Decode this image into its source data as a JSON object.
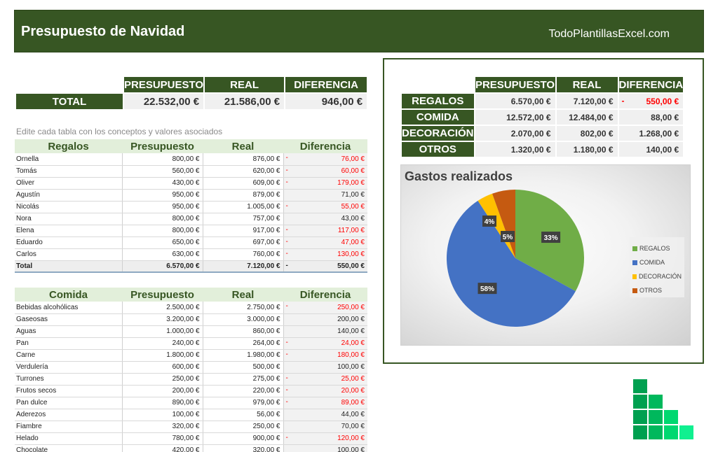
{
  "header": {
    "title": "Presupuesto de Navidad",
    "site": "TodoPlantillasExcel.com"
  },
  "summary": {
    "columns": [
      "PRESUPUESTO",
      "REAL",
      "DIFERENCIA"
    ],
    "row_label": "TOTAL",
    "values": [
      "22.532,00 €",
      "21.586,00 €",
      "946,00 €"
    ]
  },
  "hint": "Edite cada tabla con los conceptos y valores asociados",
  "tables": [
    {
      "headers": [
        "Regalos",
        "Presupuesto",
        "Real",
        "Diferencia"
      ],
      "rows": [
        {
          "name": "Ornella",
          "pre": "800,00 €",
          "real": "876,00 €",
          "dif": "76,00 €",
          "neg": true
        },
        {
          "name": "Tomás",
          "pre": "560,00 €",
          "real": "620,00 €",
          "dif": "60,00 €",
          "neg": true
        },
        {
          "name": "Oliver",
          "pre": "430,00 €",
          "real": "609,00 €",
          "dif": "179,00 €",
          "neg": true
        },
        {
          "name": "Agustín",
          "pre": "950,00 €",
          "real": "879,00 €",
          "dif": "71,00 €",
          "neg": false
        },
        {
          "name": "Nicolás",
          "pre": "950,00 €",
          "real": "1.005,00 €",
          "dif": "55,00 €",
          "neg": true
        },
        {
          "name": "Nora",
          "pre": "800,00 €",
          "real": "757,00 €",
          "dif": "43,00 €",
          "neg": false
        },
        {
          "name": "Elena",
          "pre": "800,00 €",
          "real": "917,00 €",
          "dif": "117,00 €",
          "neg": true
        },
        {
          "name": "Eduardo",
          "pre": "650,00 €",
          "real": "697,00 €",
          "dif": "47,00 €",
          "neg": true
        },
        {
          "name": "Carlos",
          "pre": "630,00 €",
          "real": "760,00 €",
          "dif": "130,00 €",
          "neg": true
        }
      ],
      "total": {
        "name": "Total",
        "pre": "6.570,00 €",
        "real": "7.120,00 €",
        "dif": "550,00 €",
        "neg": true
      }
    },
    {
      "headers": [
        "Comida",
        "Presupuesto",
        "Real",
        "Diferencia"
      ],
      "rows": [
        {
          "name": "Bebidas alcohólicas",
          "pre": "2.500,00 €",
          "real": "2.750,00 €",
          "dif": "250,00 €",
          "neg": true
        },
        {
          "name": "Gaseosas",
          "pre": "3.200,00 €",
          "real": "3.000,00 €",
          "dif": "200,00 €",
          "neg": false
        },
        {
          "name": "Aguas",
          "pre": "1.000,00 €",
          "real": "860,00 €",
          "dif": "140,00 €",
          "neg": false
        },
        {
          "name": "Pan",
          "pre": "240,00 €",
          "real": "264,00 €",
          "dif": "24,00 €",
          "neg": true
        },
        {
          "name": "Carne",
          "pre": "1.800,00 €",
          "real": "1.980,00 €",
          "dif": "180,00 €",
          "neg": true
        },
        {
          "name": "Verdulería",
          "pre": "600,00 €",
          "real": "500,00 €",
          "dif": "100,00 €",
          "neg": false
        },
        {
          "name": "Turrones",
          "pre": "250,00 €",
          "real": "275,00 €",
          "dif": "25,00 €",
          "neg": true
        },
        {
          "name": "Frutos secos",
          "pre": "200,00 €",
          "real": "220,00 €",
          "dif": "20,00 €",
          "neg": true
        },
        {
          "name": "Pan dulce",
          "pre": "890,00 €",
          "real": "979,00 €",
          "dif": "89,00 €",
          "neg": true
        },
        {
          "name": "Aderezos",
          "pre": "100,00 €",
          "real": "56,00 €",
          "dif": "44,00 €",
          "neg": false
        },
        {
          "name": "Fiambre",
          "pre": "320,00 €",
          "real": "250,00 €",
          "dif": "70,00 €",
          "neg": false
        },
        {
          "name": "Helado",
          "pre": "780,00 €",
          "real": "900,00 €",
          "dif": "120,00 €",
          "neg": true
        },
        {
          "name": "Chocolate",
          "pre": "420,00 €",
          "real": "320,00 €",
          "dif": "100,00 €",
          "neg": false
        }
      ]
    }
  ],
  "categories": {
    "columns": [
      "PRESUPUESTO",
      "REAL",
      "DIFERENCIA"
    ],
    "rows": [
      {
        "label": "REGALOS",
        "pre": "6.570,00 €",
        "real": "7.120,00 €",
        "dif": "550,00 €",
        "neg": true
      },
      {
        "label": "COMIDA",
        "pre": "12.572,00 €",
        "real": "12.484,00 €",
        "dif": "88,00 €",
        "neg": false
      },
      {
        "label": "DECORACIÓN",
        "pre": "2.070,00 €",
        "real": "802,00 €",
        "dif": "1.268,00 €",
        "neg": false
      },
      {
        "label": "OTROS",
        "pre": "1.320,00 €",
        "real": "1.180,00 €",
        "dif": "140,00 €",
        "neg": false
      }
    ]
  },
  "chart_data": {
    "type": "pie",
    "title": "Gastos realizados",
    "categories": [
      "REGALOS",
      "COMIDA",
      "DECORACIÓN",
      "OTROS"
    ],
    "values": [
      7120,
      12484,
      802,
      1180
    ],
    "labels": [
      "33%",
      "58%",
      "4%",
      "5%"
    ],
    "colors": [
      "#70ad47",
      "#4472c4",
      "#ffc000",
      "#c55a11"
    ],
    "legend": "right"
  }
}
